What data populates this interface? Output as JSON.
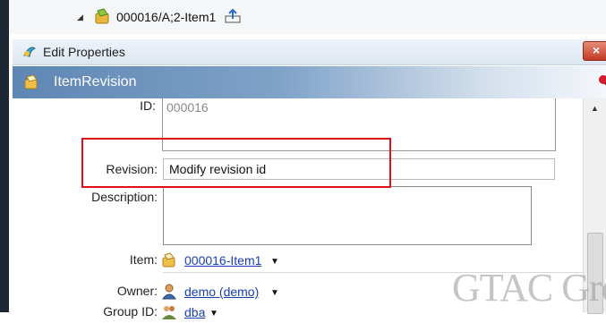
{
  "tree": {
    "item_label": "000016/A;2-Item1"
  },
  "dialog": {
    "title": "Edit Properties",
    "close_glyph": "×"
  },
  "section": {
    "title": "ItemRevision"
  },
  "form": {
    "id_label": "ID:",
    "id_value": "000016",
    "revision_label": "Revision:",
    "revision_value": "Modify revision id",
    "description_label": "Description:",
    "item_label": "Item:",
    "item_value": "000016-Item1",
    "owner_label": "Owner:",
    "owner_value": "demo (demo)",
    "group_label": "Group ID:",
    "group_value": "dba"
  },
  "watermark": "GTAC Gre",
  "icons": {
    "expander": "expand-triangle-icon",
    "tree_item": "item-revision-icon",
    "upload": "upload-icon",
    "dialog": "edit-properties-icon",
    "section": "item-revision-icon",
    "pin": "pin-icon",
    "item_ref": "item-icon",
    "owner_ref": "user-icon",
    "group_ref": "group-icon"
  },
  "colors": {
    "highlight": "#e0101a",
    "section_header": "#5e86b4",
    "link": "#1a3fb0",
    "close_button": "#c23a24"
  }
}
